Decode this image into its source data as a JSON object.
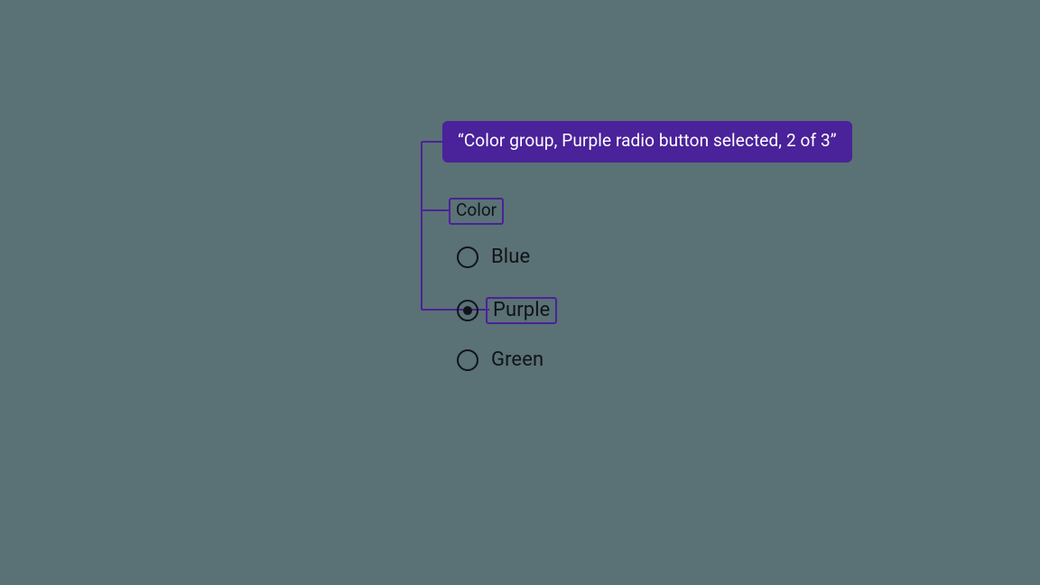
{
  "announcement": "“Color group, Purple radio button selected, 2 of 3”",
  "group_label": "Color",
  "options": {
    "blue": {
      "label": "Blue",
      "selected": false
    },
    "purple": {
      "label": "Purple",
      "selected": true
    },
    "green": {
      "label": "Green",
      "selected": false
    }
  },
  "colors": {
    "accent": "#4a229a",
    "ink": "#101418",
    "background": "#5a7175"
  }
}
